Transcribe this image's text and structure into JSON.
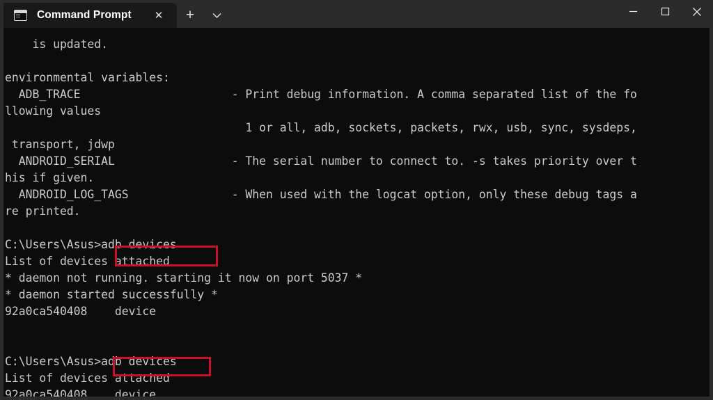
{
  "window": {
    "titlebar": {
      "tab": {
        "icon": "terminal-window-icon",
        "title": "Command Prompt",
        "close_label": "✕"
      },
      "new_tab_label": "+",
      "tab_dropdown_label": "⌄",
      "controls": {
        "minimize_label": "minimize",
        "maximize_label": "maximize",
        "close_label": "close"
      }
    },
    "colors": {
      "titlebar_bg": "#2b2b2b",
      "active_tab_bg": "#191919",
      "terminal_bg": "#0c0c0c",
      "terminal_fg": "#cccccc",
      "highlight_red": "#c81028"
    }
  },
  "terminal": {
    "prompt": "C:\\Users\\Asus>",
    "device_serial": "92a0ca540408",
    "command": "adb devices",
    "lines": [
      "    is updated.",
      "",
      "environmental variables:",
      "  ADB_TRACE                      - Print debug information. A comma separated list of the fo",
      "llowing values",
      "                                   1 or all, adb, sockets, packets, rwx, usb, sync, sysdeps,",
      " transport, jdwp",
      "  ANDROID_SERIAL                 - The serial number to connect to. -s takes priority over t",
      "his if given.",
      "  ANDROID_LOG_TAGS               - When used with the logcat option, only these debug tags a",
      "re printed.",
      "",
      "C:\\Users\\Asus>adb devices",
      "List of devices attached",
      "* daemon not running. starting it now on port 5037 *",
      "* daemon started successfully *",
      "92a0ca540408    device",
      "",
      "",
      "C:\\Users\\Asus>adb devices",
      "List of devices attached",
      "92a0ca540408    device"
    ]
  },
  "annotations": [
    {
      "name": "highlight-box-command-1",
      "target": "adb devices"
    },
    {
      "name": "highlight-box-command-2",
      "target": "adb devices"
    }
  ]
}
